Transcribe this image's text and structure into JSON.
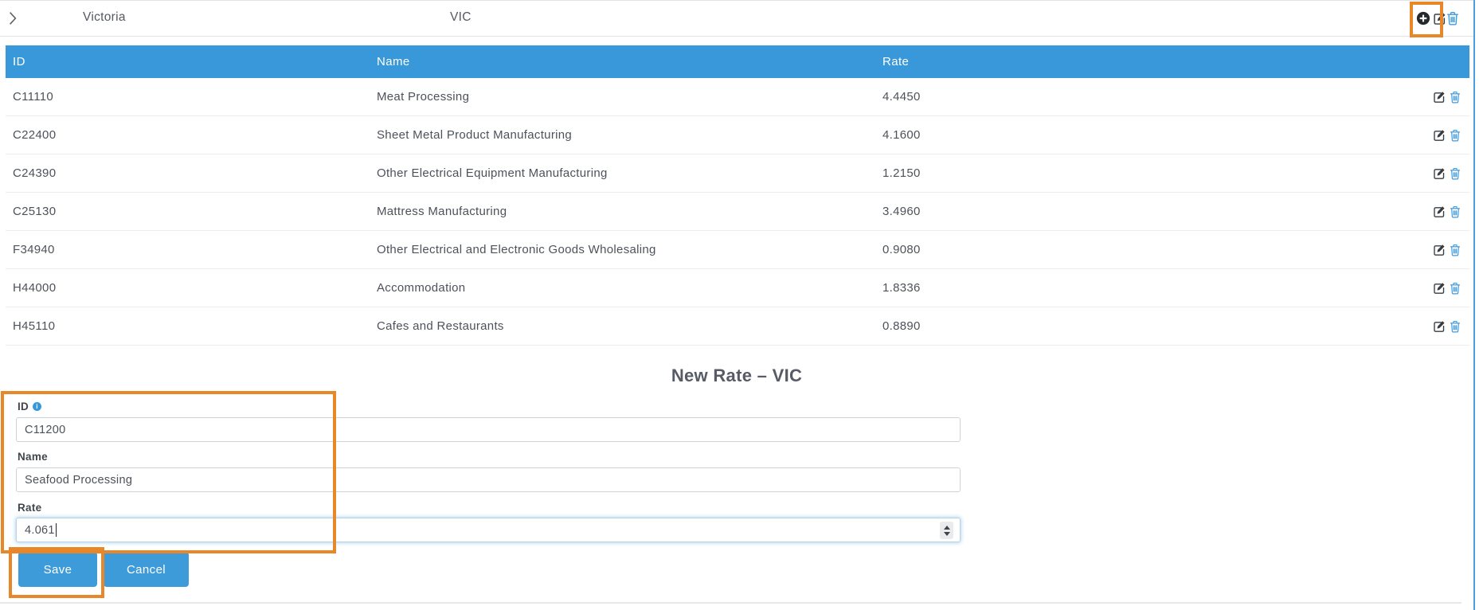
{
  "parent_row": {
    "name": "Victoria",
    "code": "VIC"
  },
  "toolbar": {
    "add": "add",
    "edit": "edit",
    "delete": "delete"
  },
  "table": {
    "columns": {
      "id": "ID",
      "name": "Name",
      "rate": "Rate"
    },
    "rows": [
      {
        "id": "C11110",
        "name": "Meat Processing",
        "rate": "4.4450"
      },
      {
        "id": "C22400",
        "name": "Sheet Metal Product Manufacturing",
        "rate": "4.1600"
      },
      {
        "id": "C24390",
        "name": "Other Electrical Equipment Manufacturing",
        "rate": "1.2150"
      },
      {
        "id": "C25130",
        "name": "Mattress Manufacturing",
        "rate": "3.4960"
      },
      {
        "id": "F34940",
        "name": "Other Electrical and Electronic Goods Wholesaling",
        "rate": "0.9080"
      },
      {
        "id": "H44000",
        "name": "Accommodation",
        "rate": "1.8336"
      },
      {
        "id": "H45110",
        "name": "Cafes and Restaurants",
        "rate": "0.8890"
      }
    ]
  },
  "form": {
    "title": "New Rate – VIC",
    "id_label": "ID",
    "id_value": "C11200",
    "name_label": "Name",
    "name_value": "Seafood Processing",
    "rate_label": "Rate",
    "rate_value": "4.061",
    "save_label": "Save",
    "cancel_label": "Cancel"
  },
  "icons": {
    "info_glyph": "i"
  },
  "colors": {
    "header_blue": "#3898da",
    "button_blue": "#3d9bd9",
    "trash_blue": "#3c99dc",
    "annotation_orange": "#e8862a"
  }
}
